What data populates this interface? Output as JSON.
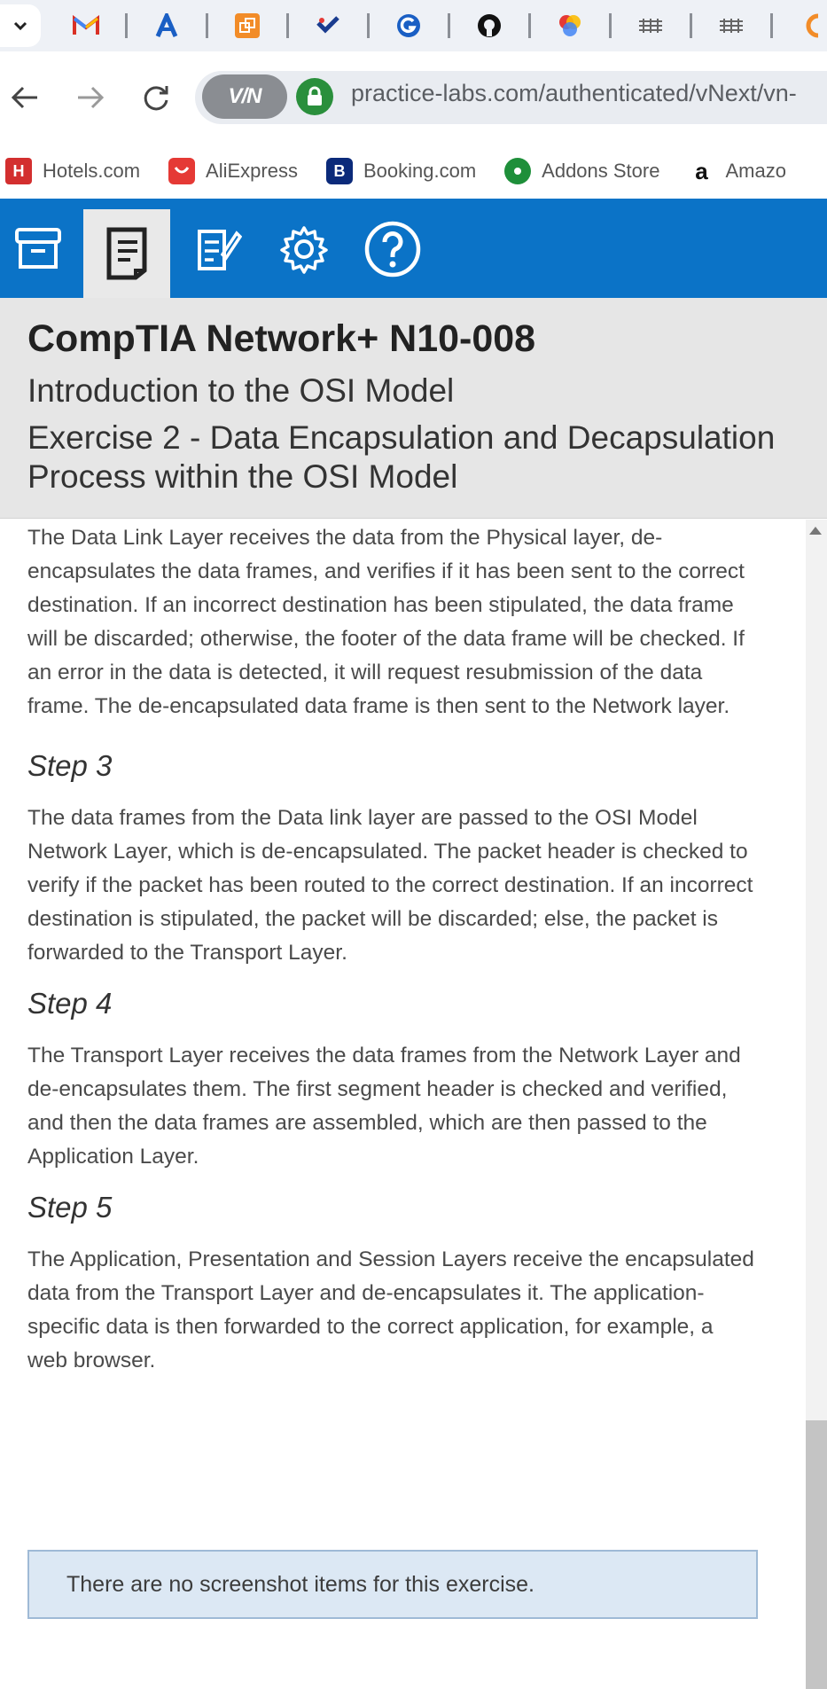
{
  "browser": {
    "address": {
      "url": "practice-labs.com/authenticated/vNext/vn-",
      "vpn_label": "V/N"
    },
    "bookmarks": [
      {
        "label": "Hotels.com",
        "icon": "hotels-icon",
        "color": "#d32f2f"
      },
      {
        "label": "AliExpress",
        "icon": "aliexpress-icon",
        "color": "#e53935"
      },
      {
        "label": "Booking.com",
        "icon": "booking-icon",
        "color": "#0b2a7a"
      },
      {
        "label": "Addons Store",
        "icon": "addons-store-icon",
        "color": "#1e8f3a"
      },
      {
        "label": "Amazo",
        "icon": "amazon-icon",
        "color": "#111111"
      }
    ]
  },
  "header": {
    "course_title": "CompTIA Network+ N10-008",
    "module_title": "Introduction to the OSI Model",
    "exercise_title": "Exercise 2 - Data Encapsulation and Decapsulation Process within the OSI Model"
  },
  "content": {
    "intro": "The Data Link Layer receives the data from the Physical layer, de-encapsulates the data frames, and verifies if it has been sent to the correct destination. If an incorrect destination has been stipulated, the data frame will be discarded; otherwise, the footer of the data frame will be checked. If an error in the data is detected, it will request resubmission of the data frame. The de-encapsulated data frame is then sent to the Network layer.",
    "steps": [
      {
        "heading": "Step 3",
        "body": "The data frames from the Data link layer are passed to the OSI Model Network Layer, which is de-encapsulated. The packet header is checked to verify if the packet has been routed to the correct destination. If an incorrect destination is stipulated, the packet will be discarded; else, the packet is forwarded to the Transport Layer."
      },
      {
        "heading": "Step 4",
        "body": "The Transport Layer receives the data frames from the Network Layer and de-encapsulates them. The first segment header is checked and verified, and then the data frames are assembled, which are then passed to the Application Layer."
      },
      {
        "heading": "Step 5",
        "body": "The Application, Presentation and Session Layers receive the encapsulated data from the Transport Layer and de-encapsulates it. The application-specific data is then forwarded to the correct application, for example, a web browser."
      }
    ],
    "notice": "There are no screenshot items for this exercise."
  },
  "colors": {
    "toolbar": "#0b73c7",
    "header_bg": "#e6e6e6",
    "notice_bg": "#dce8f4"
  }
}
